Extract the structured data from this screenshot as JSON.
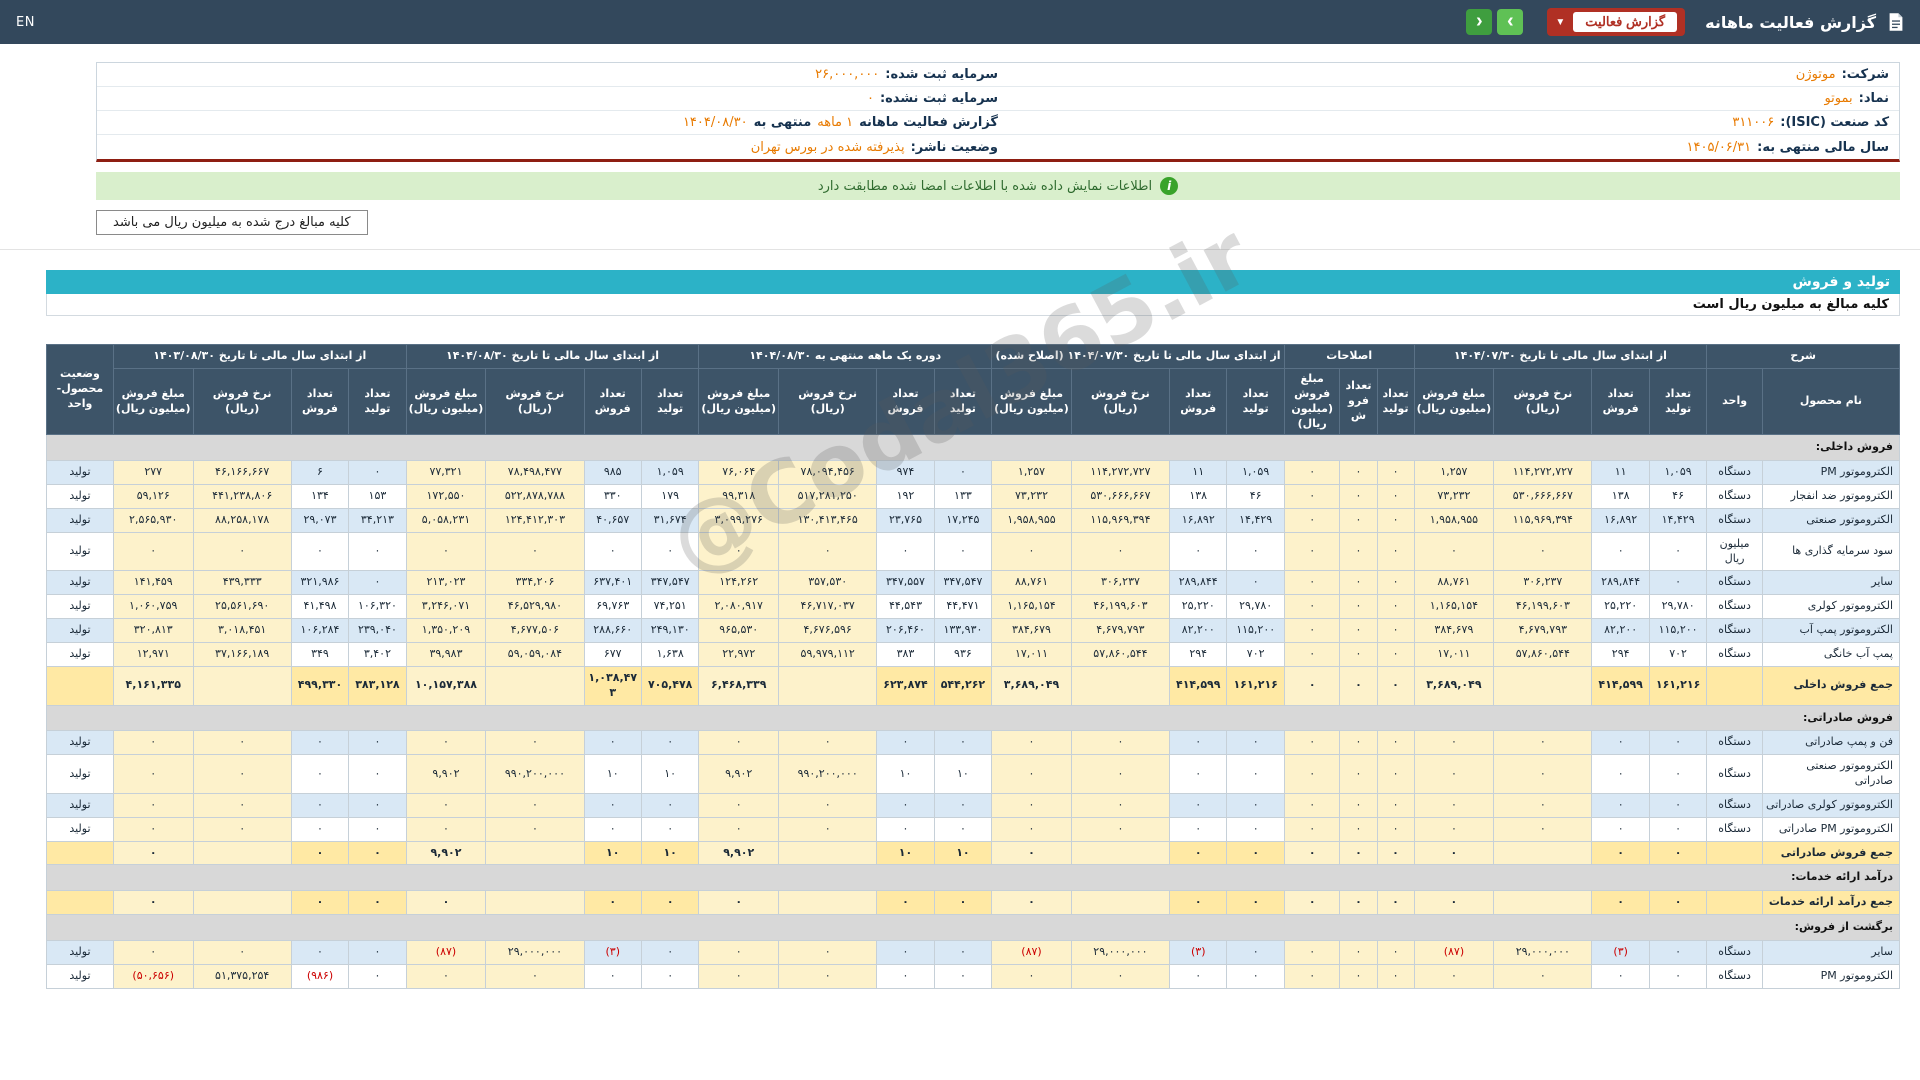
{
  "navbar": {
    "title": "گزارش فعالیت ماهانه",
    "dropdown_label": "گزارش فعالیت",
    "dropdown_caret": "▼",
    "arrow_right": "›",
    "arrow_left": "‹",
    "lang_link": "EN"
  },
  "info_panel": {
    "rows": [
      {
        "right_label": "شرکت:",
        "right_value": "موتوژن",
        "left_label": "سرمایه ثبت شده:",
        "left_value": "۲۶,۰۰۰,۰۰۰"
      },
      {
        "right_label": "نماد:",
        "right_value": "بموتو",
        "left_label": "سرمایه ثبت نشده:",
        "left_value": "۰"
      },
      {
        "right_label": "کد صنعت (ISIC):",
        "right_value": "۳۱۱۰۰۶",
        "left_label": "گزارش فعالیت ماهانه",
        "left_value": "۱ ماهه",
        "left_label2": "منتهی به",
        "left_value2": "۱۴۰۴/۰۸/۳۰"
      },
      {
        "right_label": "سال مالی منتهی به:",
        "right_value": "۱۴۰۵/۰۶/۳۱",
        "left_label": "وضعیت ناشر:",
        "left_value": "پذیرفته شده در بورس تهران"
      }
    ]
  },
  "notice": {
    "icon": "i",
    "text": "اطلاعات نمایش داده شده با اطلاعات امضا شده مطابقت دارد"
  },
  "amount_note": "کلیه مبالغ درج شده به میلیون ریال می باشد",
  "section": {
    "title": "تولید و فروش",
    "subtitle": "کلیه مبالغ به میلیون ریال است"
  },
  "watermark": "@Codal365.ir",
  "colors": {
    "navbar": "#33485c",
    "dropdown_red": "#b03024",
    "teal": "#2cb2c7",
    "value_orange": "#e87a00",
    "notice_green_bg": "#d9efcc",
    "stripe_blue": "#d9e8f5",
    "highlight_cream": "#fdf2cb",
    "total_yellow": "#ffe9a4"
  },
  "table": {
    "groups": [
      {
        "label": "شرح",
        "cols": 2
      },
      {
        "label": "از ابتدای سال مالی تا تاریخ ۱۴۰۴/۰۷/۳۰",
        "cols": 4
      },
      {
        "label": "اصلاحات",
        "cols": 3
      },
      {
        "label": "از ابتدای سال مالی تا تاریخ ۱۴۰۴/۰۷/۳۰ (اصلاح شده)",
        "cols": 4
      },
      {
        "label": "دوره یک ماهه منتهی به ۱۴۰۴/۰۸/۳۰",
        "cols": 4
      },
      {
        "label": "از ابتدای سال مالی تا تاریخ ۱۴۰۴/۰۸/۳۰",
        "cols": 4
      },
      {
        "label": "از ابتدای سال مالی تا تاریخ ۱۴۰۳/۰۸/۳۰",
        "cols": 4
      },
      {
        "label": "وضعیت محصول-واحد",
        "cols": 1,
        "full_height": true
      }
    ],
    "sub_headers": [
      "نام محصول",
      "واحد",
      "تعداد تولید",
      "تعداد فروش",
      "نرخ فروش (ریال)",
      "مبلغ فروش (میلیون ریال)",
      "تعداد تولید",
      "تعداد فروش",
      "مبلغ فروش (میلیون ریال)",
      "تعداد تولید",
      "تعداد فروش",
      "نرخ فروش (ریال)",
      "مبلغ فروش (میلیون ریال)",
      "تعداد تولید",
      "تعداد فروش",
      "نرخ فروش (ریال)",
      "مبلغ فروش (میلیون ریال)",
      "تعداد تولید",
      "تعداد فروش",
      "نرخ فروش (ریال)",
      "مبلغ فروش (میلیون ریال)",
      "تعداد تولید",
      "تعداد فروش",
      "نرخ فروش (ریال)",
      "مبلغ فروش (میلیون ریال)"
    ],
    "rows": [
      {
        "type": "section",
        "label": "فروش داخلی:"
      },
      {
        "type": "data",
        "cells": [
          "الکتروموتور PM",
          "دستگاه",
          "۱,۰۵۹",
          "۱۱",
          "۱۱۴,۲۷۲,۷۲۷",
          "۱,۲۵۷",
          "۰",
          "۰",
          "۰",
          "۱,۰۵۹",
          "۱۱",
          "۱۱۴,۲۷۲,۷۲۷",
          "۱,۲۵۷",
          "۰",
          "۹۷۴",
          "۷۸,۰۹۴,۴۵۶",
          "۷۶,۰۶۴",
          "۱,۰۵۹",
          "۹۸۵",
          "۷۸,۴۹۸,۴۷۷",
          "۷۷,۳۲۱",
          "۰",
          "۶",
          "۴۶,۱۶۶,۶۶۷",
          "۲۷۷",
          "تولید"
        ]
      },
      {
        "type": "data",
        "cells": [
          "الکتروموتور ضد انفجار",
          "دستگاه",
          "۴۶",
          "۱۳۸",
          "۵۳۰,۶۶۶,۶۶۷",
          "۷۳,۲۳۲",
          "۰",
          "۰",
          "۰",
          "۴۶",
          "۱۳۸",
          "۵۳۰,۶۶۶,۶۶۷",
          "۷۳,۲۳۲",
          "۱۳۳",
          "۱۹۲",
          "۵۱۷,۲۸۱,۲۵۰",
          "۹۹,۳۱۸",
          "۱۷۹",
          "۳۳۰",
          "۵۲۲,۸۷۸,۷۸۸",
          "۱۷۲,۵۵۰",
          "۱۵۳",
          "۱۳۴",
          "۴۴۱,۲۳۸,۸۰۶",
          "۵۹,۱۲۶",
          "تولید"
        ]
      },
      {
        "type": "data",
        "cells": [
          "الکتروموتور صنعتی",
          "دستگاه",
          "۱۴,۴۲۹",
          "۱۶,۸۹۲",
          "۱۱۵,۹۶۹,۳۹۴",
          "۱,۹۵۸,۹۵۵",
          "۰",
          "۰",
          "۰",
          "۱۴,۴۲۹",
          "۱۶,۸۹۲",
          "۱۱۵,۹۶۹,۳۹۴",
          "۱,۹۵۸,۹۵۵",
          "۱۷,۲۴۵",
          "۲۳,۷۶۵",
          "۱۳۰,۴۱۳,۴۶۵",
          "۳,۰۹۹,۲۷۶",
          "۳۱,۶۷۴",
          "۴۰,۶۵۷",
          "۱۲۴,۴۱۲,۳۰۳",
          "۵,۰۵۸,۲۳۱",
          "۳۴,۲۱۳",
          "۲۹,۰۷۳",
          "۸۸,۲۵۸,۱۷۸",
          "۲,۵۶۵,۹۳۰",
          "تولید"
        ]
      },
      {
        "type": "data",
        "cells": [
          "سود سرمایه گذاری ها",
          "میلیون ریال",
          "۰",
          "۰",
          "۰",
          "۰",
          "۰",
          "۰",
          "۰",
          "۰",
          "۰",
          "۰",
          "۰",
          "۰",
          "۰",
          "۰",
          "۰",
          "۰",
          "۰",
          "۰",
          "۰",
          "۰",
          "۰",
          "۰",
          "۰",
          "تولید"
        ]
      },
      {
        "type": "data",
        "cells": [
          "سایر",
          "دستگاه",
          "۰",
          "۲۸۹,۸۴۴",
          "۳۰۶,۲۳۷",
          "۸۸,۷۶۱",
          "۰",
          "۰",
          "۰",
          "۰",
          "۲۸۹,۸۴۴",
          "۳۰۶,۲۳۷",
          "۸۸,۷۶۱",
          "۳۴۷,۵۴۷",
          "۳۴۷,۵۵۷",
          "۳۵۷,۵۳۰",
          "۱۲۴,۲۶۲",
          "۳۴۷,۵۴۷",
          "۶۳۷,۴۰۱",
          "۳۳۴,۲۰۶",
          "۲۱۳,۰۲۳",
          "۰",
          "۳۲۱,۹۸۶",
          "۴۳۹,۳۳۳",
          "۱۴۱,۴۵۹",
          "تولید"
        ]
      },
      {
        "type": "data",
        "cells": [
          "الکتروموتور کولری",
          "دستگاه",
          "۲۹,۷۸۰",
          "۲۵,۲۲۰",
          "۴۶,۱۹۹,۶۰۳",
          "۱,۱۶۵,۱۵۴",
          "۰",
          "۰",
          "۰",
          "۲۹,۷۸۰",
          "۲۵,۲۲۰",
          "۴۶,۱۹۹,۶۰۳",
          "۱,۱۶۵,۱۵۴",
          "۴۴,۴۷۱",
          "۴۴,۵۴۳",
          "۴۶,۷۱۷,۰۳۷",
          "۲,۰۸۰,۹۱۷",
          "۷۴,۲۵۱",
          "۶۹,۷۶۳",
          "۴۶,۵۲۹,۹۸۰",
          "۳,۲۴۶,۰۷۱",
          "۱۰۶,۳۲۰",
          "۴۱,۴۹۸",
          "۲۵,۵۶۱,۶۹۰",
          "۱,۰۶۰,۷۵۹",
          "تولید"
        ]
      },
      {
        "type": "data",
        "cells": [
          "الکتروموتور پمپ آب",
          "دستگاه",
          "۱۱۵,۲۰۰",
          "۸۲,۲۰۰",
          "۴,۶۷۹,۷۹۳",
          "۳۸۴,۶۷۹",
          "۰",
          "۰",
          "۰",
          "۱۱۵,۲۰۰",
          "۸۲,۲۰۰",
          "۴,۶۷۹,۷۹۳",
          "۳۸۴,۶۷۹",
          "۱۳۳,۹۳۰",
          "۲۰۶,۴۶۰",
          "۴,۶۷۶,۵۹۶",
          "۹۶۵,۵۳۰",
          "۲۴۹,۱۳۰",
          "۲۸۸,۶۶۰",
          "۴,۶۷۷,۵۰۶",
          "۱,۳۵۰,۲۰۹",
          "۲۳۹,۰۴۰",
          "۱۰۶,۲۸۴",
          "۳,۰۱۸,۴۵۱",
          "۳۲۰,۸۱۳",
          "تولید"
        ]
      },
      {
        "type": "data",
        "cells": [
          "پمپ آب خانگی",
          "دستگاه",
          "۷۰۲",
          "۲۹۴",
          "۵۷,۸۶۰,۵۴۴",
          "۱۷,۰۱۱",
          "۰",
          "۰",
          "۰",
          "۷۰۲",
          "۲۹۴",
          "۵۷,۸۶۰,۵۴۴",
          "۱۷,۰۱۱",
          "۹۳۶",
          "۳۸۳",
          "۵۹,۹۷۹,۱۱۲",
          "۲۲,۹۷۲",
          "۱,۶۳۸",
          "۶۷۷",
          "۵۹,۰۵۹,۰۸۴",
          "۳۹,۹۸۳",
          "۳,۴۰۲",
          "۳۴۹",
          "۳۷,۱۶۶,۱۸۹",
          "۱۲,۹۷۱",
          "تولید"
        ]
      },
      {
        "type": "total",
        "cells": [
          "جمع فروش داخلی",
          "",
          "۱۶۱,۲۱۶",
          "۴۱۴,۵۹۹",
          "",
          "۳,۶۸۹,۰۴۹",
          "۰",
          "۰",
          "۰",
          "۱۶۱,۲۱۶",
          "۴۱۴,۵۹۹",
          "",
          "۳,۶۸۹,۰۴۹",
          "۵۴۴,۲۶۲",
          "۶۲۳,۸۷۴",
          "",
          "۶,۴۶۸,۳۳۹",
          "۷۰۵,۴۷۸",
          "۱,۰۳۸,۴۷۳",
          "",
          "۱۰,۱۵۷,۳۸۸",
          "۳۸۳,۱۲۸",
          "۴۹۹,۳۳۰",
          "",
          "۴,۱۶۱,۳۳۵",
          ""
        ]
      },
      {
        "type": "section",
        "label": "فروش صادراتی:"
      },
      {
        "type": "data",
        "cells": [
          "فن و پمپ صادراتی",
          "دستگاه",
          "۰",
          "۰",
          "۰",
          "۰",
          "۰",
          "۰",
          "۰",
          "۰",
          "۰",
          "۰",
          "۰",
          "۰",
          "۰",
          "۰",
          "۰",
          "۰",
          "۰",
          "۰",
          "۰",
          "۰",
          "۰",
          "۰",
          "۰",
          "تولید"
        ]
      },
      {
        "type": "data",
        "cells": [
          "الکتروموتور صنعتی صادراتی",
          "دستگاه",
          "۰",
          "۰",
          "۰",
          "۰",
          "۰",
          "۰",
          "۰",
          "۰",
          "۰",
          "۰",
          "۰",
          "۱۰",
          "۱۰",
          "۹۹۰,۲۰۰,۰۰۰",
          "۹,۹۰۲",
          "۱۰",
          "۱۰",
          "۹۹۰,۲۰۰,۰۰۰",
          "۹,۹۰۲",
          "۰",
          "۰",
          "۰",
          "۰",
          "تولید"
        ]
      },
      {
        "type": "data",
        "cells": [
          "الکتروموتور کولری صادراتی",
          "دستگاه",
          "۰",
          "۰",
          "۰",
          "۰",
          "۰",
          "۰",
          "۰",
          "۰",
          "۰",
          "۰",
          "۰",
          "۰",
          "۰",
          "۰",
          "۰",
          "۰",
          "۰",
          "۰",
          "۰",
          "۰",
          "۰",
          "۰",
          "۰",
          "تولید"
        ]
      },
      {
        "type": "data",
        "cells": [
          "الکتروموتور PM صادراتی",
          "دستگاه",
          "۰",
          "۰",
          "۰",
          "۰",
          "۰",
          "۰",
          "۰",
          "۰",
          "۰",
          "۰",
          "۰",
          "۰",
          "۰",
          "۰",
          "۰",
          "۰",
          "۰",
          "۰",
          "۰",
          "۰",
          "۰",
          "۰",
          "۰",
          "تولید"
        ]
      },
      {
        "type": "total",
        "cells": [
          "جمع فروش صادراتی",
          "",
          "۰",
          "۰",
          "",
          "۰",
          "۰",
          "۰",
          "۰",
          "۰",
          "۰",
          "",
          "۰",
          "۱۰",
          "۱۰",
          "",
          "۹,۹۰۲",
          "۱۰",
          "۱۰",
          "",
          "۹,۹۰۲",
          "۰",
          "۰",
          "",
          "۰",
          ""
        ]
      },
      {
        "type": "section",
        "label": "درآمد ارائه خدمات:"
      },
      {
        "type": "total",
        "cells": [
          "جمع درآمد ارائه خدمات",
          "",
          "۰",
          "۰",
          "",
          "۰",
          "۰",
          "۰",
          "۰",
          "۰",
          "۰",
          "",
          "۰",
          "۰",
          "۰",
          "",
          "۰",
          "۰",
          "۰",
          "",
          "۰",
          "۰",
          "۰",
          "",
          "۰",
          ""
        ]
      },
      {
        "type": "section",
        "label": "برگشت از فروش:"
      },
      {
        "type": "data",
        "cells": [
          "سایر",
          "دستگاه",
          "۰",
          "(۳)",
          "۲۹,۰۰۰,۰۰۰",
          "(۸۷)",
          "۰",
          "۰",
          "۰",
          "۰",
          "(۳)",
          "۲۹,۰۰۰,۰۰۰",
          "(۸۷)",
          "۰",
          "۰",
          "۰",
          "۰",
          "۰",
          "(۳)",
          "۲۹,۰۰۰,۰۰۰",
          "(۸۷)",
          "۰",
          "۰",
          "۰",
          "۰",
          "تولید"
        ]
      },
      {
        "type": "data",
        "cells": [
          "الکتروموتور PM",
          "دستگاه",
          "۰",
          "۰",
          "۰",
          "۰",
          "۰",
          "۰",
          "۰",
          "۰",
          "۰",
          "۰",
          "۰",
          "۰",
          "۰",
          "۰",
          "۰",
          "۰",
          "۰",
          "۰",
          "۰",
          "۰",
          "(۹۸۶)",
          "۵۱,۳۷۵,۲۵۴",
          "(۵۰,۶۵۶)",
          "تولید"
        ]
      }
    ]
  }
}
